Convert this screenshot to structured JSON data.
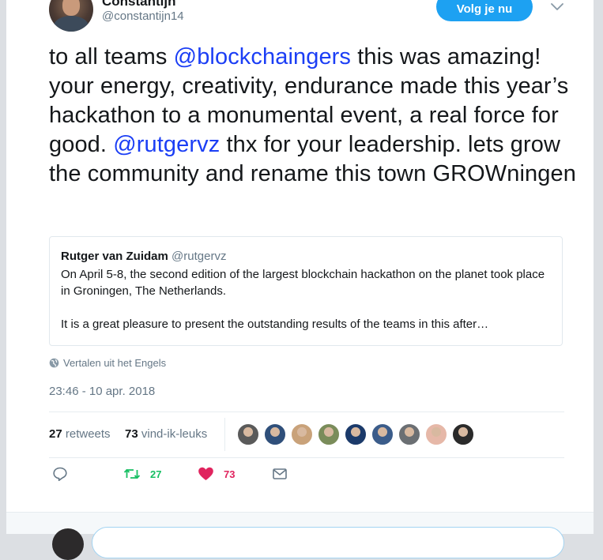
{
  "header": {
    "username": "Constantijn",
    "handle": "@constantijn14",
    "follow_label": "Volg je nu"
  },
  "tweet": {
    "text_1": "to all teams ",
    "mention_1": "@blockchaingers",
    "text_2": " this was amazing! your energy, creativity, endurance made this year’s hackathon to a monumental event, a real force for good. ",
    "mention_2": "@rutgervz",
    "text_3": " thx for your leadership. lets grow the community and rename this town GROWningen"
  },
  "quote": {
    "name": "Rutger van Zuidam",
    "handle": "@rutgervz",
    "line_1": "On April 5-8, the second edition of the largest blockchain hackathon on the planet took place in Groningen, The Netherlands.",
    "line_2": "It is a great pleasure to present the outstanding results of the teams in this after…"
  },
  "translate_label": "Vertalen uit het Engels",
  "timestamp": "23:46 - 10 apr. 2018",
  "stats": {
    "retweets_count": "27",
    "retweets_label": "retweets",
    "likes_count": "73",
    "likes_label": "vind-ik-leuks"
  },
  "likers": [
    {
      "name": "liker-avatar-1",
      "color": "#5a5a5a"
    },
    {
      "name": "liker-avatar-2",
      "color": "#2f4f7a"
    },
    {
      "name": "liker-avatar-3",
      "color": "#c9a27a"
    },
    {
      "name": "liker-avatar-4",
      "color": "#7a8c5a"
    },
    {
      "name": "liker-avatar-5",
      "color": "#1b3a6a"
    },
    {
      "name": "liker-avatar-6",
      "color": "#3b5c8a"
    },
    {
      "name": "liker-avatar-7",
      "color": "#6b6f73"
    },
    {
      "name": "liker-avatar-8",
      "color": "#e6b8a8"
    },
    {
      "name": "liker-avatar-9",
      "color": "#2a2a2a"
    }
  ],
  "actions": {
    "retweet_count": "27",
    "like_count": "73",
    "retweet_color": "#17bf63",
    "like_color": "#e0245e"
  },
  "colors": {
    "accent": "#1da1f2",
    "mention": "#1b3ef5"
  }
}
